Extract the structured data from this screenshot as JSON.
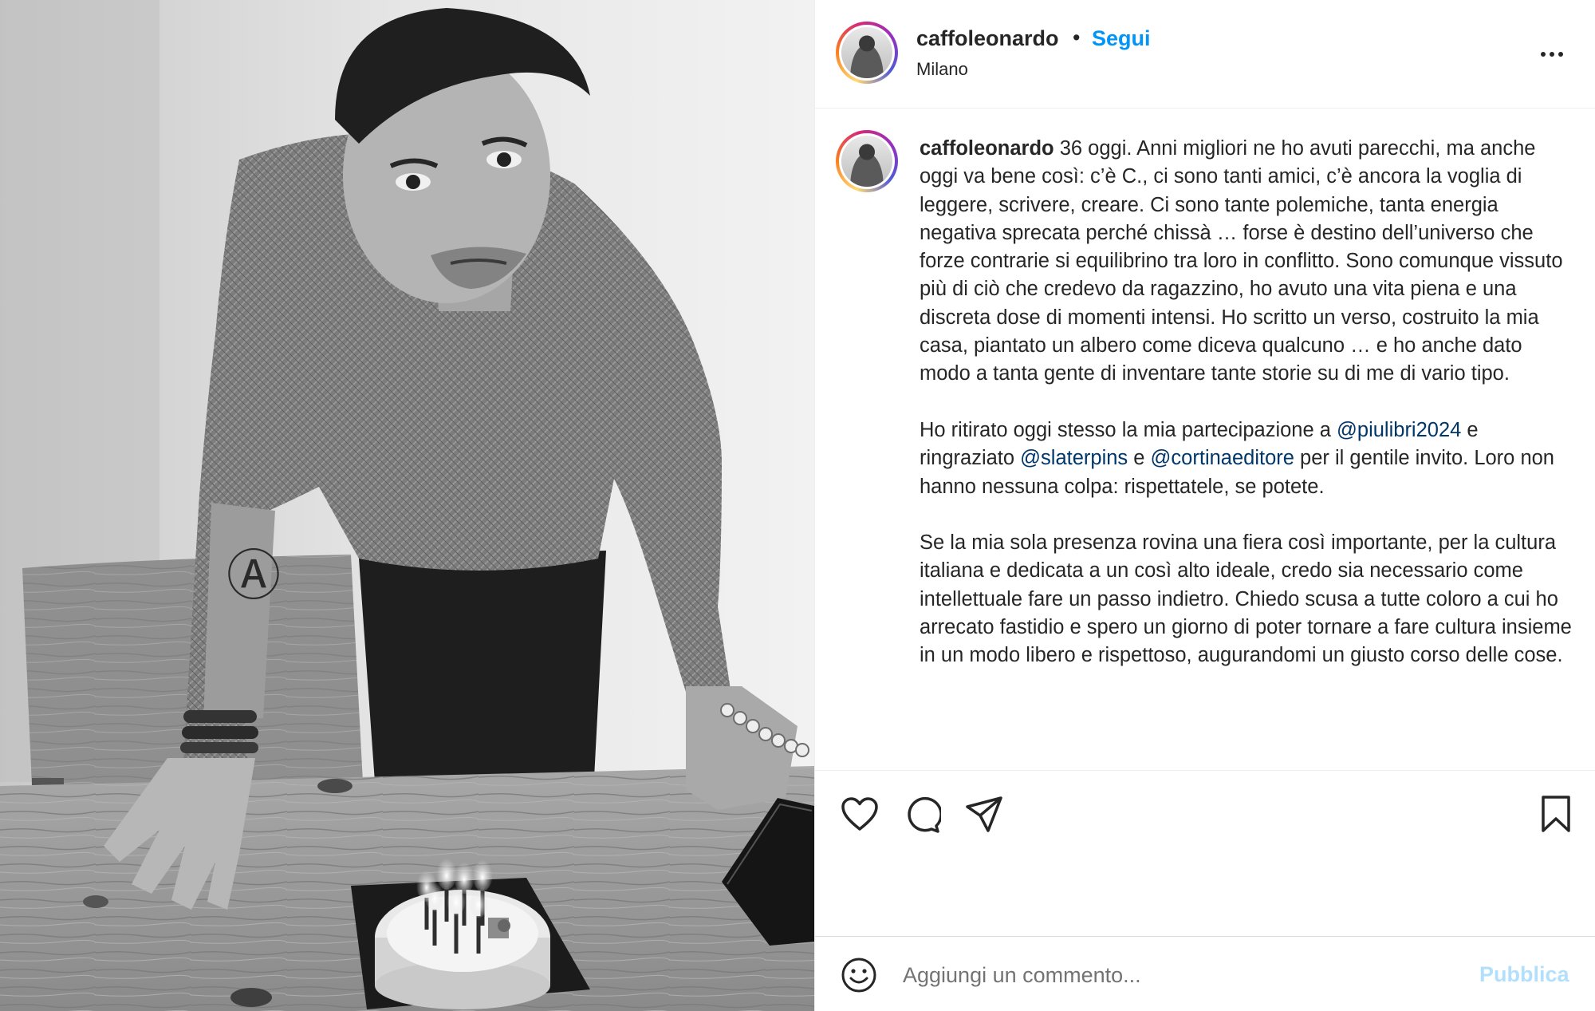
{
  "post": {
    "username": "caffoleonardo",
    "separator": "•",
    "follow_label": "Segui",
    "location": "Milano"
  },
  "caption": {
    "username": "caffoleonardo",
    "p1": " 36 oggi. Anni migliori ne ho avuti parecchi, ma anche oggi va bene così: c’è C., ci sono tanti amici, c’è ancora la voglia di leggere, scrivere, creare. Ci sono tante polemiche, tanta energia negativa sprecata perché chissà … forse è destino dell’universo che forze contrarie si equilibrino tra loro in conflitto. Sono comunque vissuto più di ciò che credevo da ragazzino, ho avuto una vita piena e una discreta dose di momenti intensi. Ho scritto un verso, costruito la mia casa, piantato un albero come diceva qualcuno … e ho anche dato modo a tanta gente di inventare tante storie su di me di vario tipo.",
    "p2_a": "Ho ritirato oggi stesso la mia partecipazione a ",
    "mention1": "@piulibri2024",
    "p2_b": " e ringraziato ",
    "mention2": "@slaterpins",
    "p2_c": " e ",
    "mention3": "@cortinaeditore",
    "p2_d": " per il gentile invito. Loro non hanno nessuna colpa: rispettatele, se potete.",
    "p3": "Se la mia sola presenza rovina una fiera così importante, per la cultura italiana e dedicata a un così alto ideale, credo sia necessario come intellettuale fare un passo indietro. Chiedo scusa a tutte coloro a cui ho arrecato fastidio e spero un giorno di poter tornare a fare cultura insieme in un modo libero e rispettoso, augurandomi un giusto corso delle cose."
  },
  "actions": {
    "icons": [
      "heart-icon",
      "comment-icon",
      "share-icon",
      "bookmark-icon"
    ]
  },
  "comment_box": {
    "placeholder": "Aggiungi un commento...",
    "publish_label": "Pubblica",
    "emoji_icon": "smiley-icon"
  },
  "colors": {
    "link_blue": "#0095f6",
    "mention_blue": "#00376b",
    "publish_disabled": "#b2dffc",
    "text": "#262626",
    "muted": "#737373"
  }
}
